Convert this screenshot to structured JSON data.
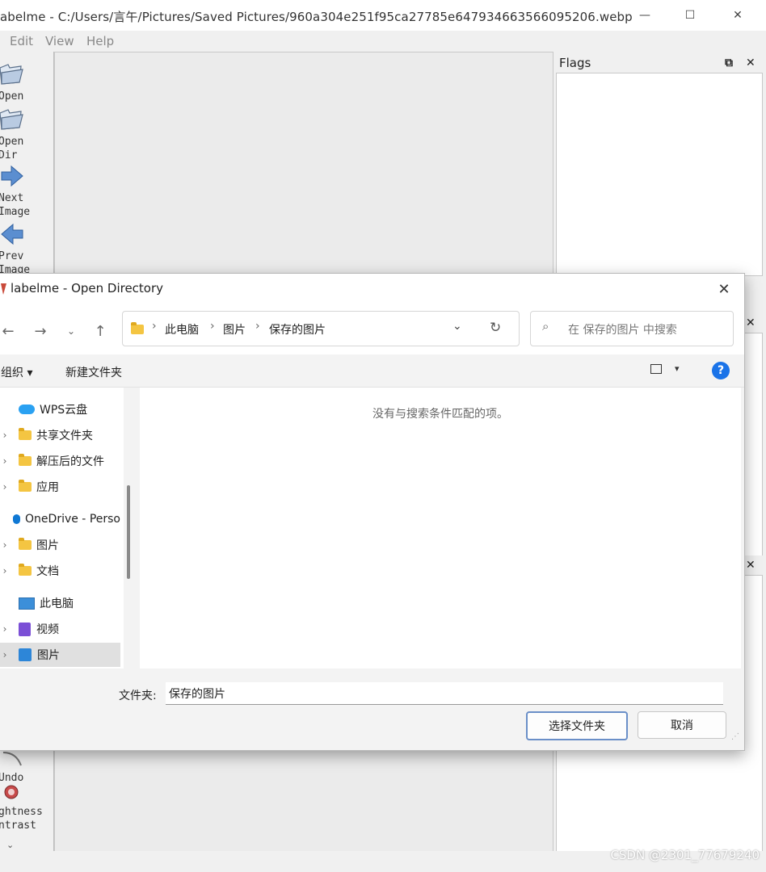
{
  "window": {
    "title": "abelme - C:/Users/言午/Pictures/Saved Pictures/960a304e251f95ca27785e647934663566095206.webp",
    "minimize": "—",
    "maximize": "☐",
    "close": "✕"
  },
  "menu": [
    "Edit",
    "View",
    "Help"
  ],
  "toolbar": {
    "open": "Open",
    "open_dir": "Open\nDir",
    "next_image": "Next\nImage",
    "prev_image": "Prev\nImage",
    "undo": "Undo",
    "brightness": "ghtness\nntrast"
  },
  "docks": {
    "flags_title": "Flags",
    "float": "⧉",
    "close": "✕"
  },
  "watermark": "CSDN @2301_77679240",
  "dialog": {
    "title": "labelme - Open Directory",
    "close": "✕",
    "breadcrumb": [
      "此电脑",
      "图片",
      "保存的图片"
    ],
    "search_placeholder": "在 保存的图片 中搜索",
    "organize": "组织 ▾",
    "new_folder": "新建文件夹",
    "help": "?",
    "nav": [
      {
        "label": "WPS云盘"
      },
      {
        "label": "共享文件夹"
      },
      {
        "label": "解压后的文件"
      },
      {
        "label": "应用"
      },
      {
        "label": "OneDrive - Perso"
      },
      {
        "label": "图片"
      },
      {
        "label": "文档"
      },
      {
        "label": "此电脑"
      },
      {
        "label": "视频"
      },
      {
        "label": "图片"
      }
    ],
    "empty_message": "没有与搜索条件匹配的项。",
    "folder_label": "文件夹:",
    "folder_value": "保存的图片",
    "select_button": "选择文件夹",
    "cancel_button": "取消"
  },
  "colors": {
    "accent": "#1a73e8",
    "folder": "#f4c542",
    "onedrive": "#0f78d4",
    "wps": "#2aa1f2"
  }
}
